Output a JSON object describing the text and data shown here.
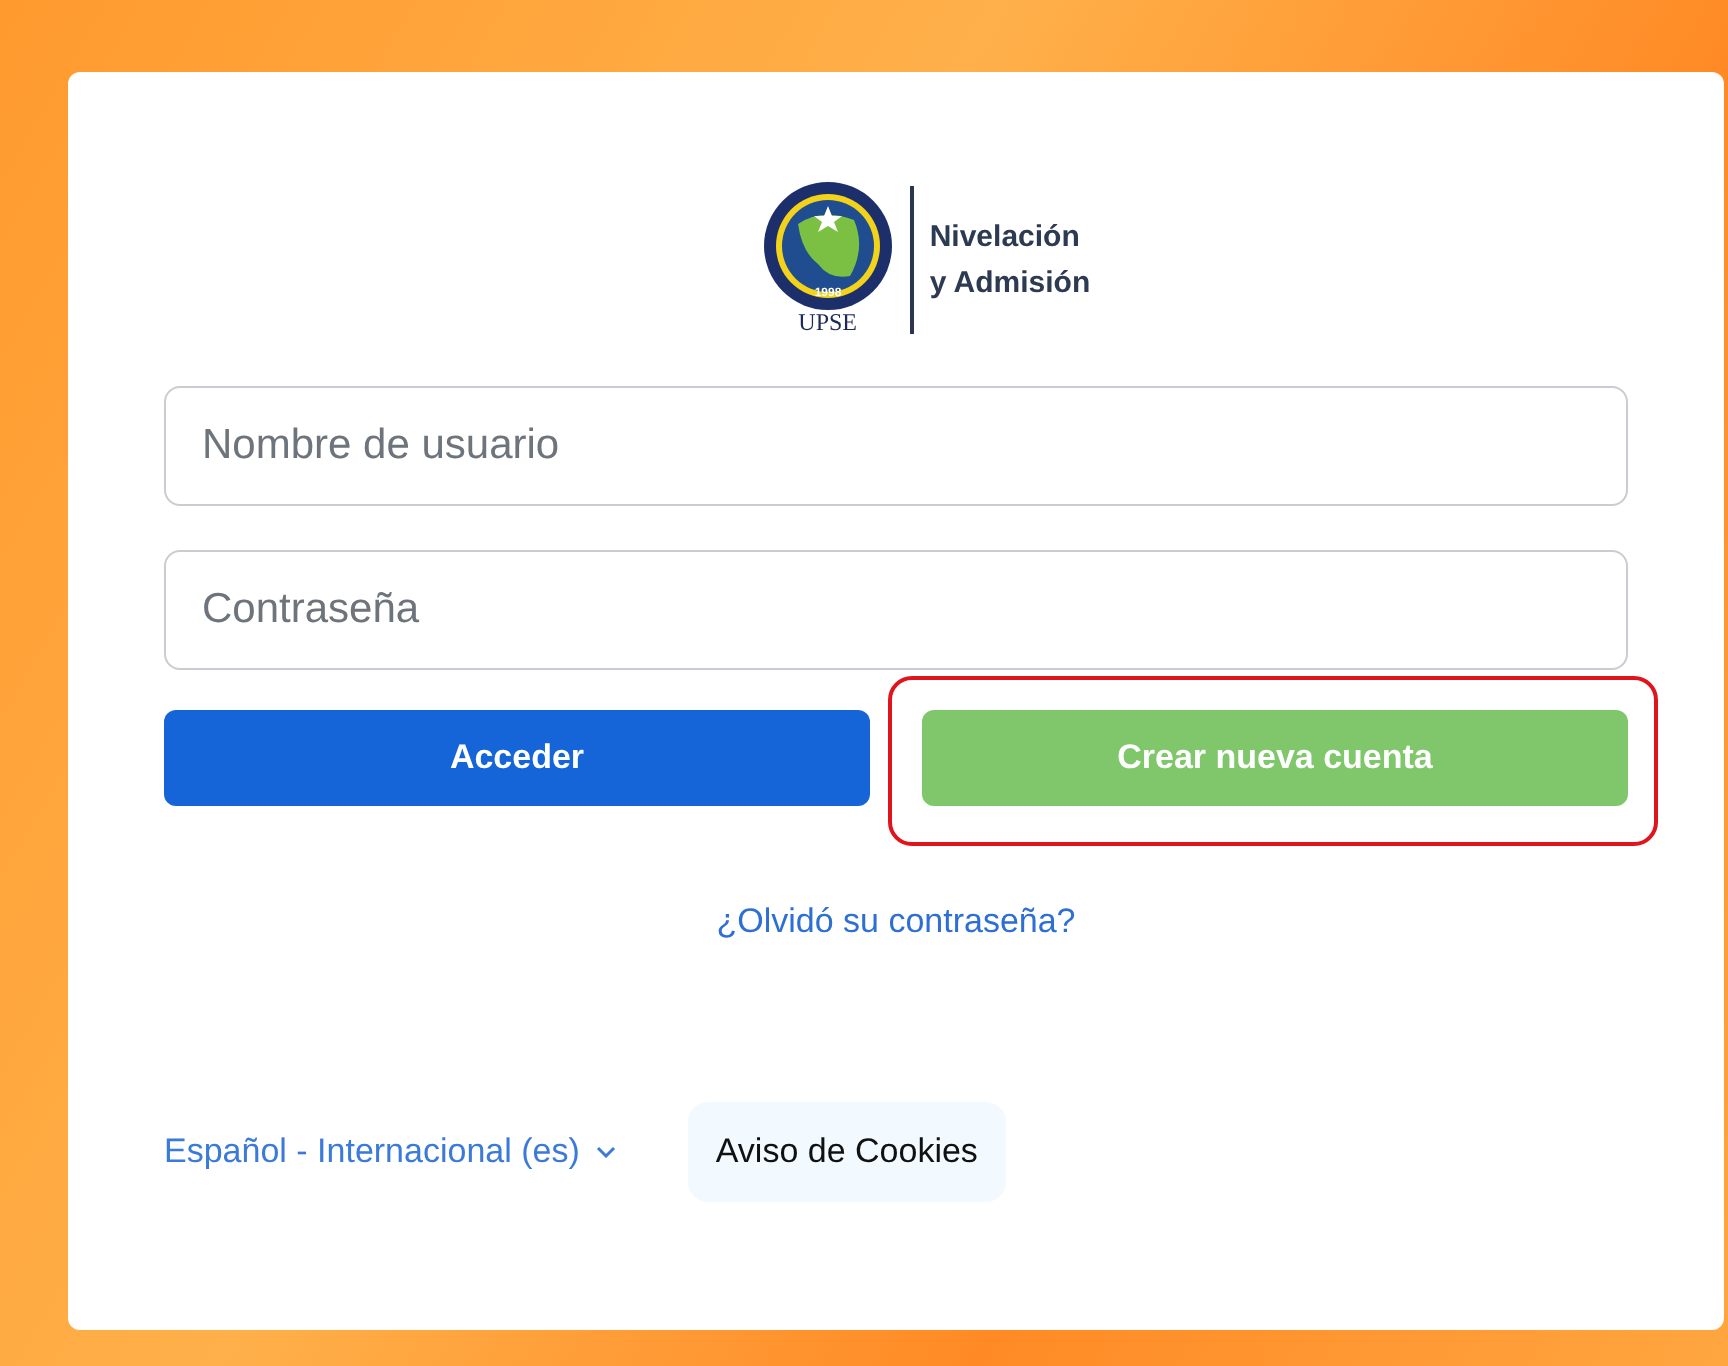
{
  "logo": {
    "seal_year": "1998",
    "seal_caption": "UPSE",
    "title_line_1": "Nivelación",
    "title_line_2": "y Admisión"
  },
  "fields": [
    {
      "placeholder": "Nombre de usuario"
    },
    {
      "placeholder": "Contraseña"
    }
  ],
  "buttons": [
    {
      "label": "Acceder",
      "kind": "primary",
      "highlighted": false
    },
    {
      "label": "Crear nueva cuenta",
      "kind": "secondary",
      "highlighted": true
    }
  ],
  "forgot_link": "¿Olvidó su contraseña?",
  "language": {
    "label": "Español - Internacional (es)"
  },
  "cookies_button": "Aviso de Cookies"
}
